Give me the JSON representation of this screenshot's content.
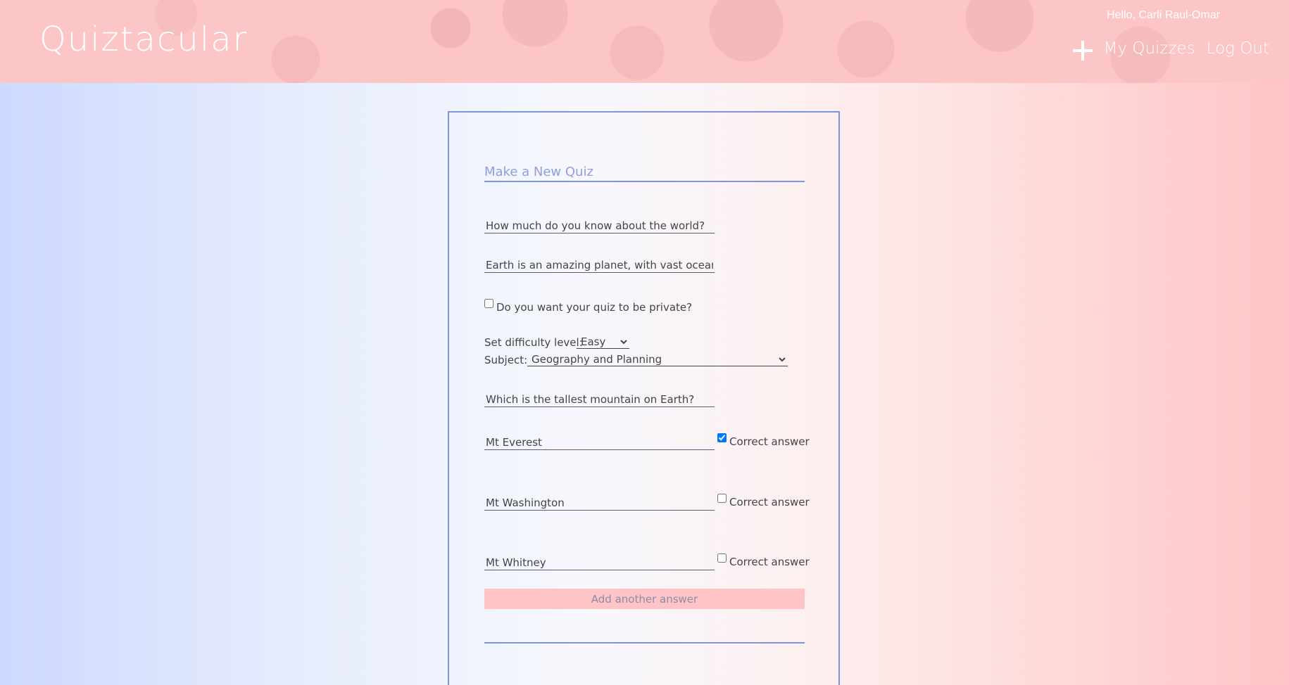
{
  "header": {
    "logo": "Quiztacular",
    "greeting": "Hello, Carli Raul-Omar",
    "nav": {
      "new_quiz_icon": "plus-icon",
      "my_quizzes": "My Quizzes",
      "log_out": "Log Out"
    }
  },
  "form": {
    "title": "Make a New Quiz",
    "quiz_title_value": "How much do you know about the world?",
    "quiz_description_value": "Earth is an amazing planet, with vast oceans, h",
    "private_label": "Do you want your quiz to be private?",
    "private_checked": false,
    "difficulty_label": "Set difficulty level:",
    "difficulty_value": "Easy",
    "subject_label": "Subject:",
    "subject_value": "Geography and Planning",
    "question_value": "Which is the tallest mountain on Earth?",
    "answers": [
      {
        "value": "Mt Everest",
        "correct_label": "Correct answer",
        "checked": true
      },
      {
        "value": "Mt Washington",
        "correct_label": "Correct answer",
        "checked": false
      },
      {
        "value": "Mt Whitney",
        "correct_label": "Correct answer",
        "checked": false
      }
    ],
    "add_answer_label": "Add another answer"
  },
  "colors": {
    "header_pink": "#fcc6c6",
    "accent_blue": "#7f95d8",
    "button_pink": "#ffc4c6"
  }
}
